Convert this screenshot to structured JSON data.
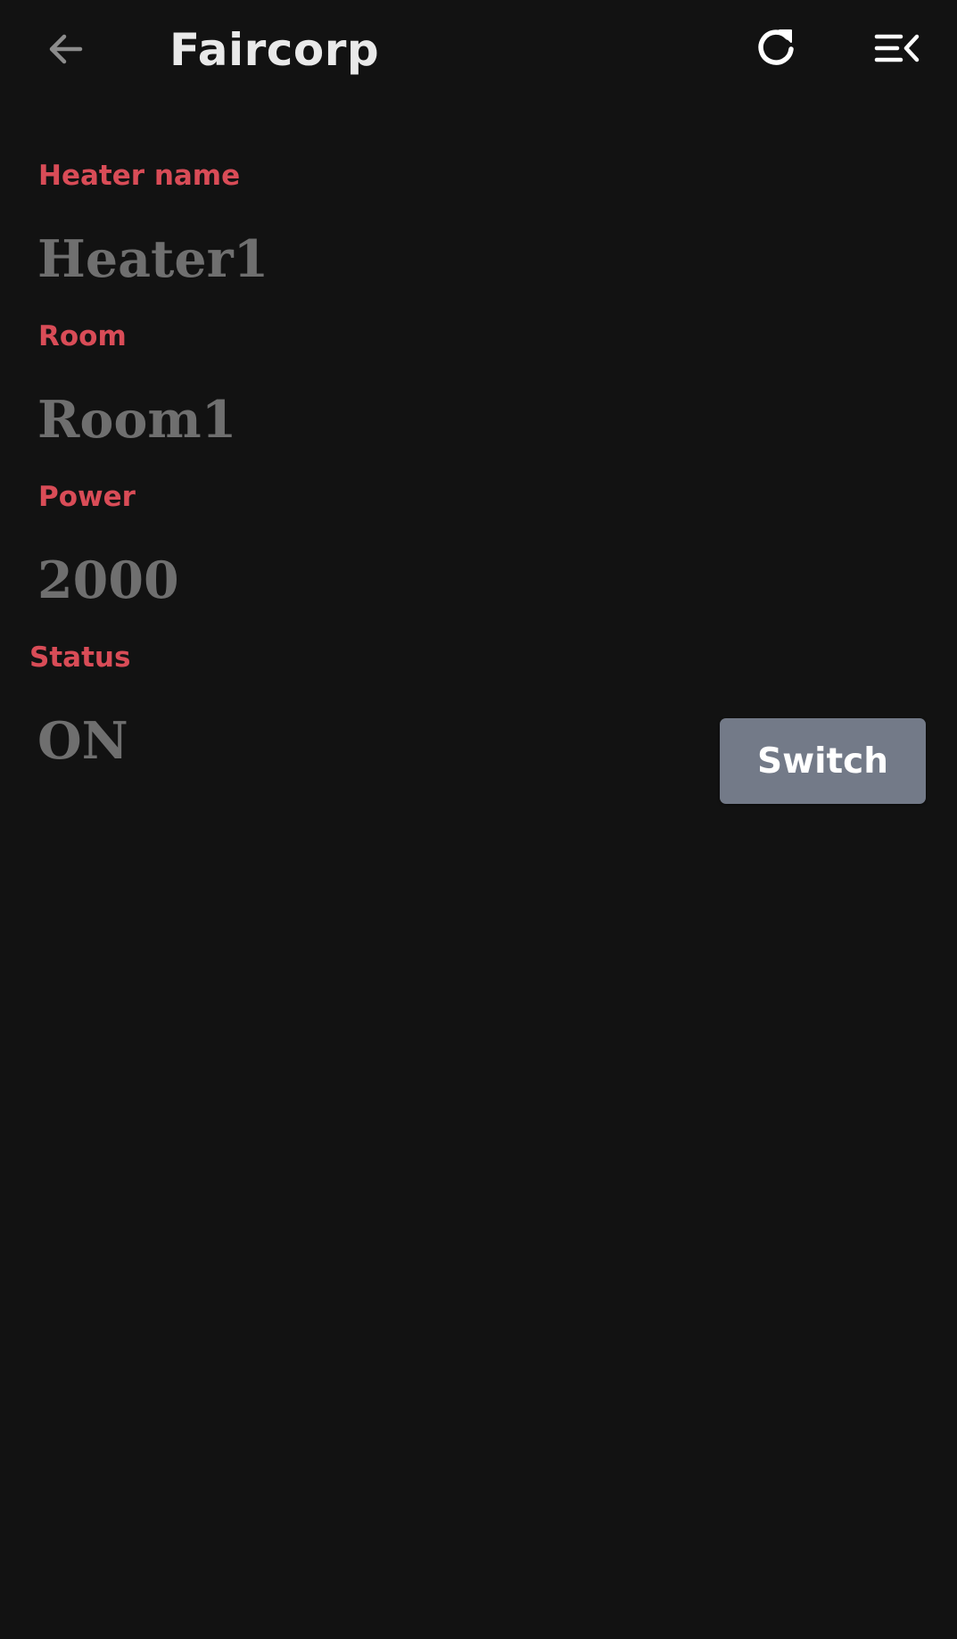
{
  "app_bar": {
    "title": "Faircorp",
    "back_icon": "arrow-back-icon",
    "refresh_icon": "refresh-icon",
    "menu_icon": "menu-collapse-icon"
  },
  "heater": {
    "name_label": "Heater name",
    "name_value": "Heater1",
    "room_label": "Room",
    "room_value": "Room1",
    "power_label": "Power",
    "power_value": "2000",
    "status_label": "Status",
    "status_value": "ON",
    "switch_label": "Switch"
  },
  "colors": {
    "background": "#121212",
    "label_accent": "#d94c57",
    "value_text": "#6f6f6f",
    "button_bg": "#737a88"
  }
}
